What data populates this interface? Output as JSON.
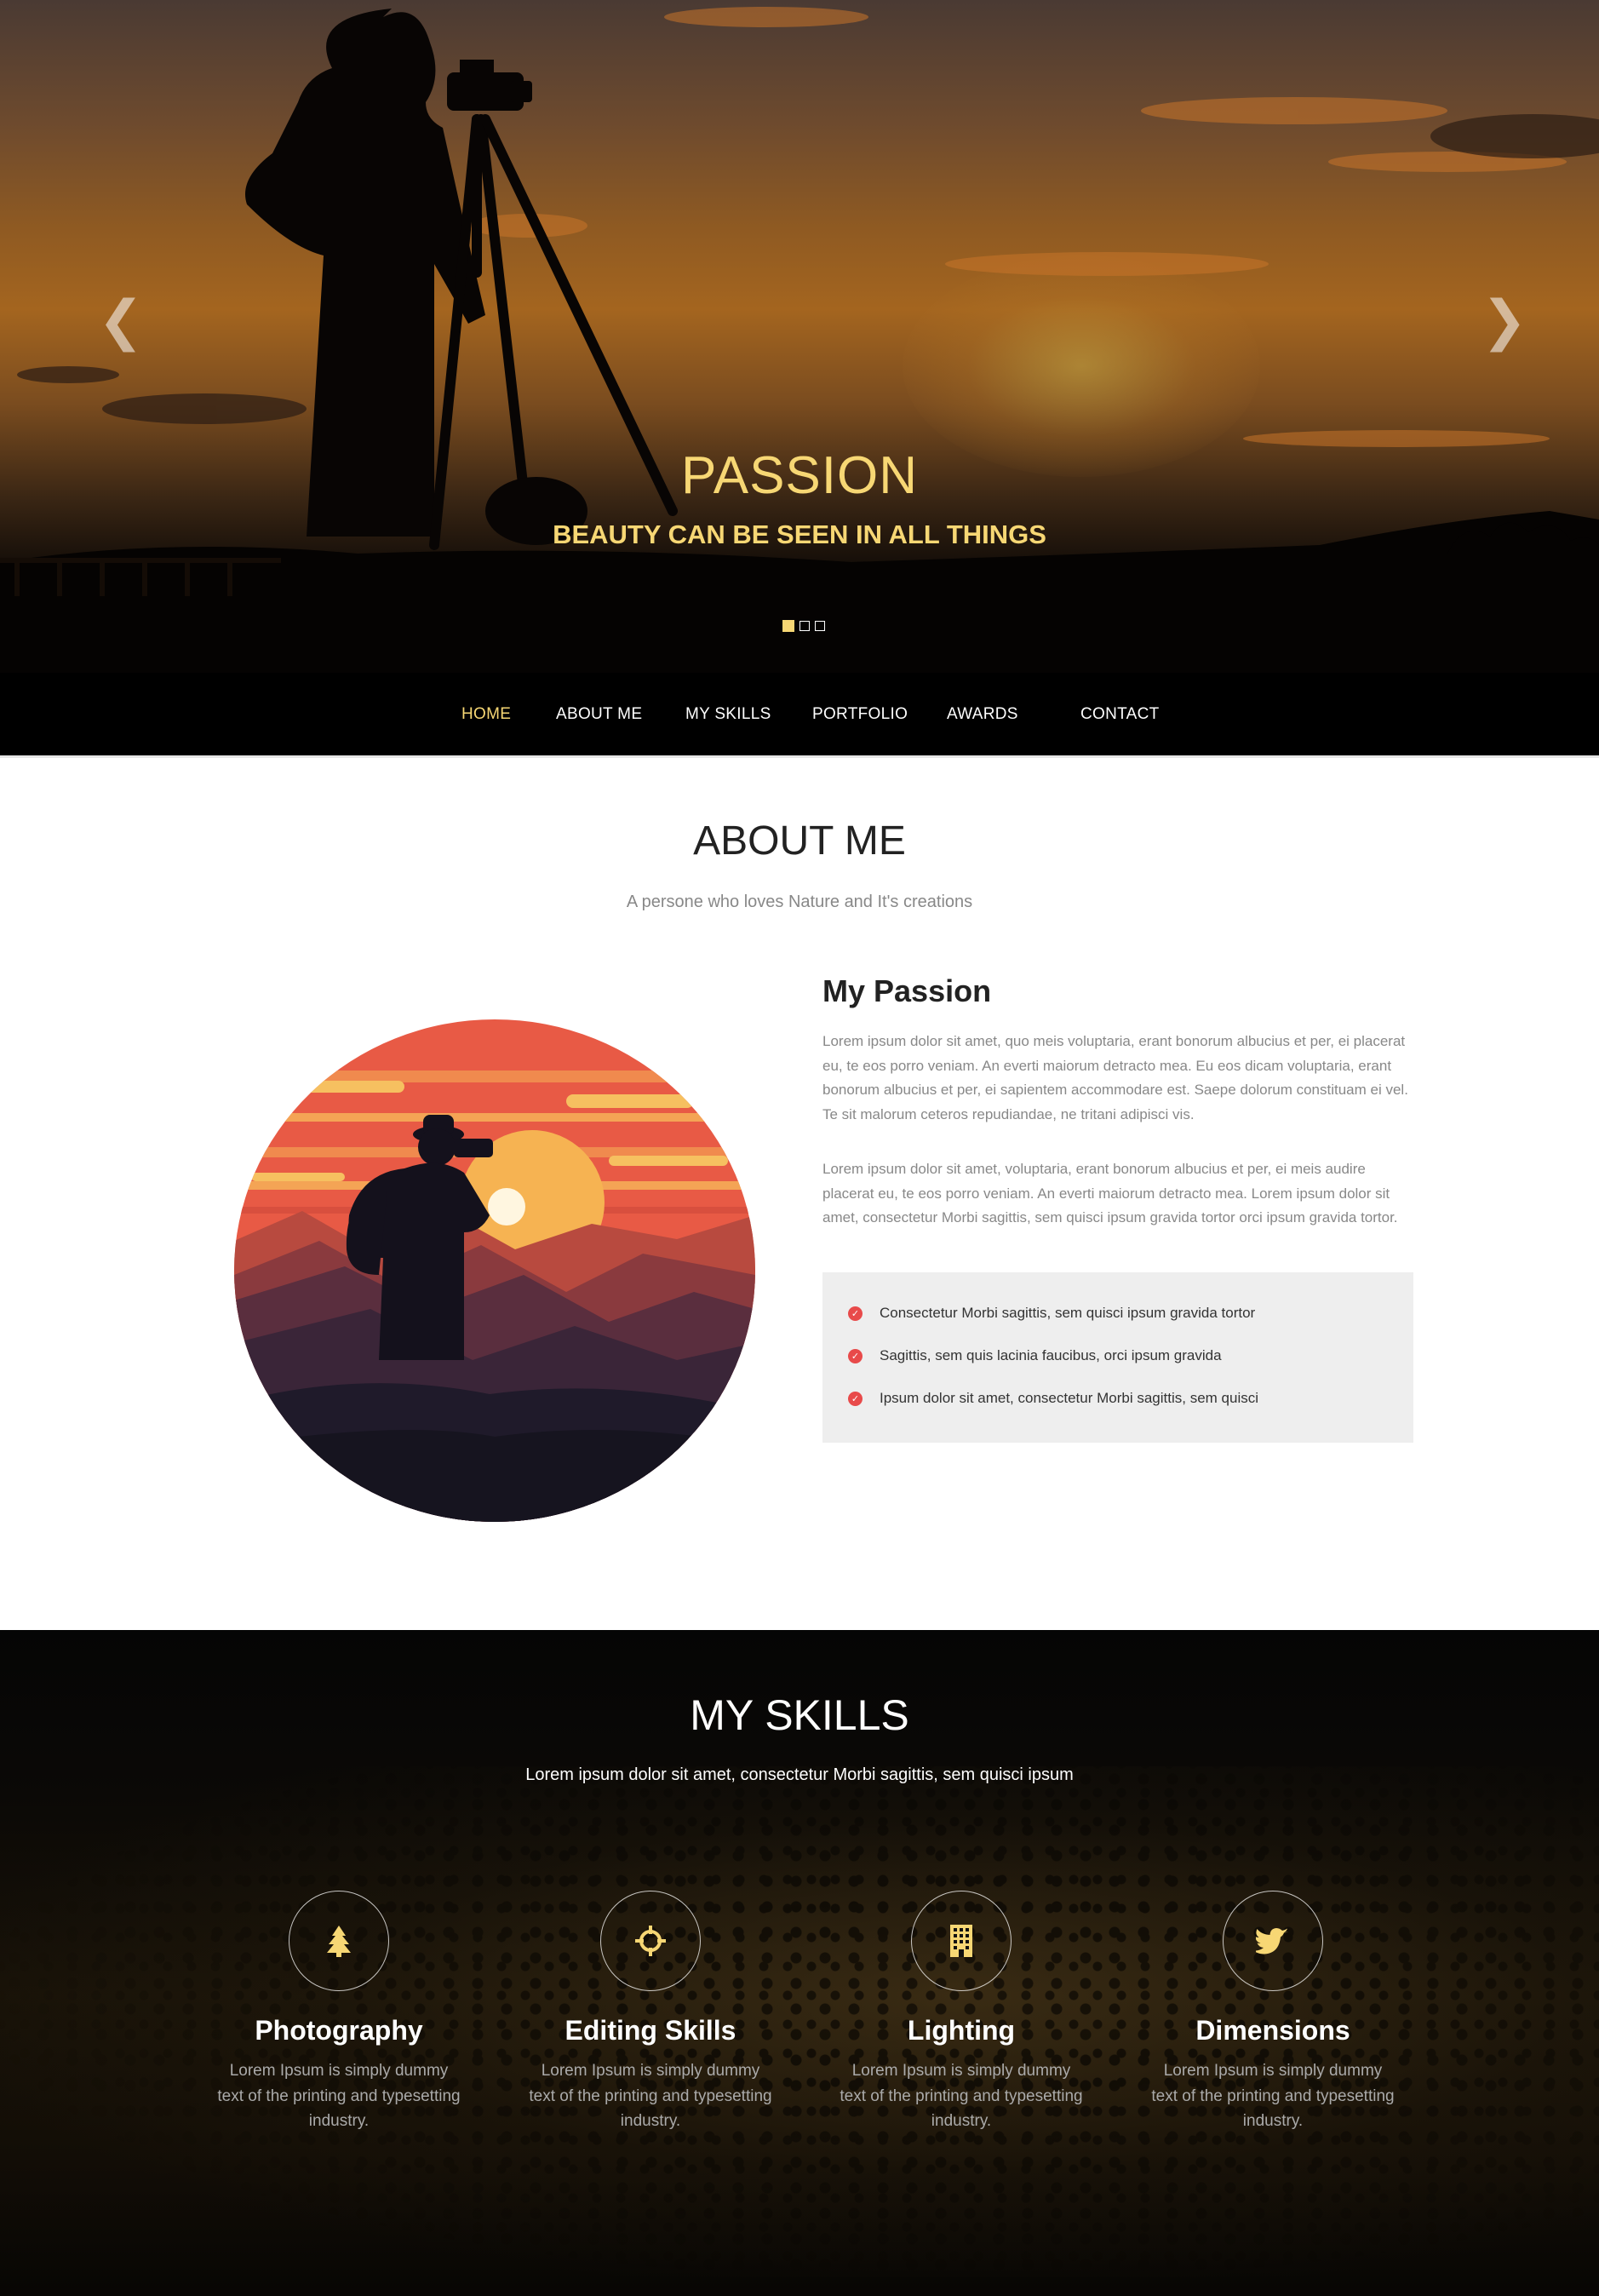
{
  "hero": {
    "title": "PASSION",
    "subtitle": "BEAUTY CAN BE SEEN IN ALL THINGS",
    "prev_arrow": "❮",
    "next_arrow": "❯",
    "slides_total": 3,
    "active_slide": 1
  },
  "nav": {
    "items": [
      {
        "label": "HOME",
        "active": true
      },
      {
        "label": "ABOUT ME",
        "active": false
      },
      {
        "label": "MY SKILLS",
        "active": false
      },
      {
        "label": "PORTFOLIO",
        "active": false
      },
      {
        "label": "AWARDS",
        "active": false
      },
      {
        "label": "CONTACT",
        "active": false
      }
    ]
  },
  "about": {
    "title": "ABOUT ME",
    "subtitle": "A persone who loves Nature and It's creations",
    "heading": "My Passion",
    "paragraphs": [
      "Lorem ipsum dolor sit amet, quo meis voluptaria, erant bonorum albucius et per, ei placerat eu, te eos porro veniam. An everti maiorum detracto mea. Eu eos dicam voluptaria, erant bonorum albucius et per, ei sapientem accommodare est. Saepe dolorum constituam ei vel. Te sit malorum ceteros repudiandae, ne tritani adipisci vis.",
      "Lorem ipsum dolor sit amet, voluptaria, erant bonorum albucius et per, ei meis audire placerat eu, te eos porro veniam. An everti maiorum detracto mea. Lorem ipsum dolor sit amet, consectetur Morbi sagittis, sem quisci ipsum gravida tortor orci ipsum gravida tortor."
    ],
    "checklist": [
      "Consectetur Morbi sagittis, sem quisci ipsum gravida tortor",
      "Sagittis, sem quis lacinia faucibus, orci ipsum gravida",
      "Ipsum dolor sit amet, consectetur Morbi sagittis, sem quisci"
    ],
    "check_icon": "check-circle-icon"
  },
  "skills": {
    "title": "MY SKILLS",
    "subtitle": "Lorem ipsum dolor sit amet, consectetur Morbi sagittis, sem quisci ipsum",
    "items": [
      {
        "icon": "tree-icon",
        "title": "Photography",
        "text": "Lorem Ipsum is simply dummy text of the printing and typesetting industry."
      },
      {
        "icon": "crosshair-icon",
        "title": "Editing Skills",
        "text": "Lorem Ipsum is simply dummy text of the printing and typesetting industry."
      },
      {
        "icon": "building-icon",
        "title": "Lighting",
        "text": "Lorem Ipsum is simply dummy text of the printing and typesetting industry."
      },
      {
        "icon": "twitter-icon",
        "title": "Dimensions",
        "text": "Lorem Ipsum is simply dummy text of the printing and typesetting industry."
      }
    ]
  },
  "colors": {
    "accent": "#f7d774",
    "check": "#e84a4a",
    "nav_bg": "#000000"
  }
}
